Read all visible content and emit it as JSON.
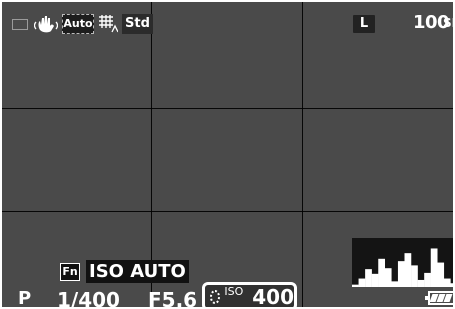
{
  "camera": {
    "top_icons": {
      "stabilization_icon": "hand-shake-icon",
      "auto_label": "Auto",
      "grid_mode_icon": "grid-display-icon",
      "style_label": "Std"
    },
    "image_size": "L",
    "shots_remaining": "100",
    "storage_label": "SD",
    "fn_label": "Fn",
    "iso_mode_label": "ISO AUTO",
    "mode_label": "P",
    "shutter_speed": "1/400",
    "aperture": "F5.6",
    "iso_indicator_label": "ISO",
    "iso_value": "400",
    "histogram": {
      "type": "histogram",
      "bars": [
        0.05,
        0.18,
        0.38,
        0.28,
        0.6,
        0.4,
        0.12,
        0.55,
        0.72,
        0.46,
        0.15,
        0.3,
        0.82,
        0.52,
        0.18,
        0.08
      ]
    },
    "battery_icon": "battery-icon",
    "colors": {
      "background": "#4a4a4a",
      "text": "#ffffff",
      "overlay": "#111111",
      "histogram_bg": "#000000"
    }
  }
}
